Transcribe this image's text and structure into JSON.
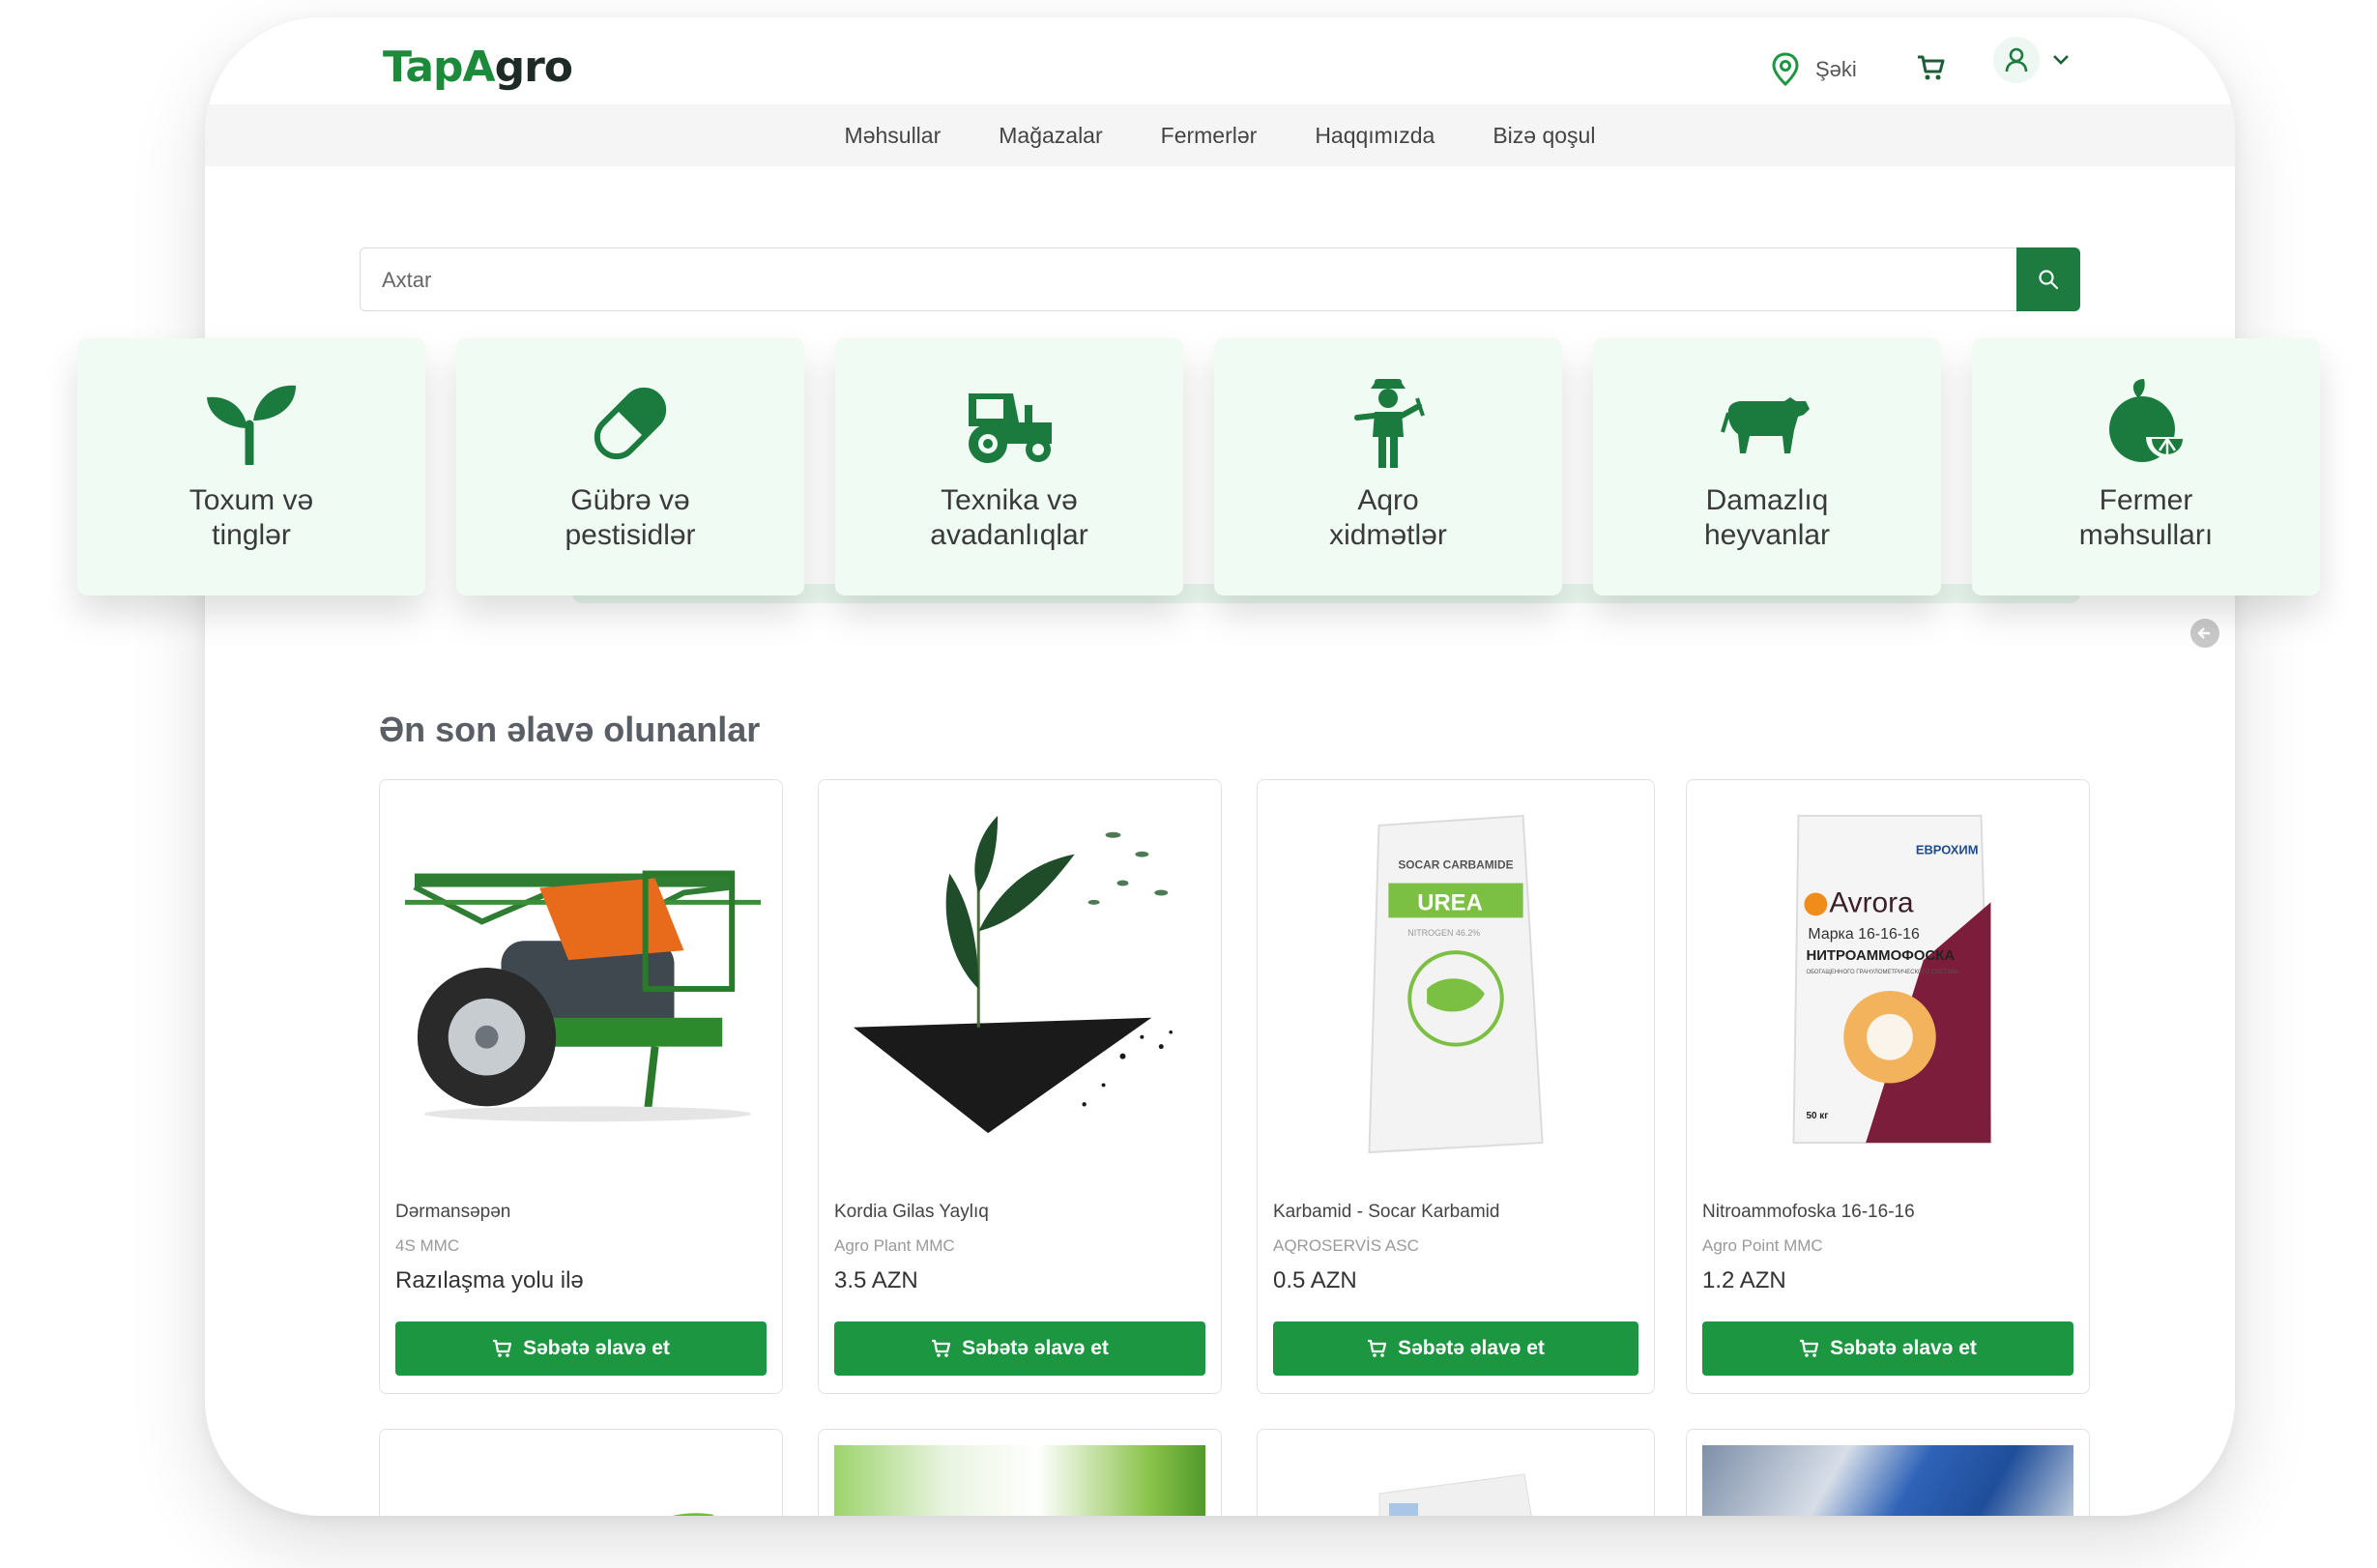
{
  "brand": {
    "part1": "Tap",
    "part2": "A",
    "part3": "gro"
  },
  "header": {
    "location": "Şəki"
  },
  "nav": [
    "Məhsullar",
    "Mağazalar",
    "Fermerlər",
    "Haqqımızda",
    "Bizə qoşul"
  ],
  "search": {
    "placeholder": "Axtar"
  },
  "categories": [
    {
      "line1": "Toxum və",
      "line2": "tinglər",
      "icon": "sprout-icon"
    },
    {
      "line1": "Gübrə və",
      "line2": "pestisidlər",
      "icon": "capsule-icon"
    },
    {
      "line1": "Texnika və",
      "line2": "avadanlıqlar",
      "icon": "tractor-icon"
    },
    {
      "line1": "Aqro",
      "line2": "xidmətlər",
      "icon": "farmer-icon"
    },
    {
      "line1": "Damazlıq",
      "line2": "heyvanlar",
      "icon": "cow-icon"
    },
    {
      "line1": "Fermer",
      "line2": "məhsulları",
      "icon": "fruit-icon"
    }
  ],
  "section": {
    "title": "Ən son əlavə olunanlar"
  },
  "products": [
    {
      "name": "Dərmansəpən",
      "store": "4S MMC",
      "price": "Razılaşma yolu ilə",
      "button": "Səbətə əlavə et"
    },
    {
      "name": "Kordia Gilas Yaylıq",
      "store": "Agro Plant MMC",
      "price": "3.5 AZN",
      "button": "Səbətə əlavə et"
    },
    {
      "name": "Karbamid - Socar Karbamid",
      "store": "AQROSERVİS ASC",
      "price": "0.5 AZN",
      "button": "Səbətə əlavə et"
    },
    {
      "name": "Nitroammofoska 16-16-16",
      "store": "Agro Point MMC",
      "price": "1.2 AZN",
      "button": "Səbətə əlavə et"
    }
  ],
  "product_images": {
    "urea_brand": "SOCAR CARBAMIDE",
    "urea_label": "UREA",
    "urea_sub": "NITROGEN 46.2%",
    "avrora_maker": "ЕВРОХИМ",
    "avrora_name": "Avrora",
    "avrora_grade": "Марка 16-16-16",
    "avrora_product": "НИТРОАММОФОСКА",
    "avrora_desc": "ОБОГАЩЕННОГО ГРАНУЛОМЕТРИЧЕСКОГО СОСТАВА",
    "avrora_weight": "50 кг"
  },
  "colors": {
    "primary": "#1d9641",
    "dark_green": "#1e7b40",
    "category_bg": "#effbf3"
  }
}
